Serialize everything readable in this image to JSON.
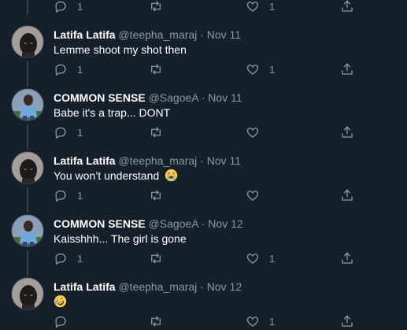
{
  "colors": {
    "background": "#15202b",
    "text": "#ffffff",
    "muted": "#8899a6",
    "line": "#38444d"
  },
  "top_actions": {
    "reply_count": "1",
    "like_count": "1"
  },
  "tweets": [
    {
      "name": "Latifa Latifa",
      "handle": "@teepha_maraj",
      "date": "Nov 11",
      "text": "Lemme shoot my shot then",
      "emoji": "",
      "reply_count": "1",
      "retweet_count": "",
      "like_count": "1"
    },
    {
      "name": "COMMON SENSE",
      "handle": "@SagoeA",
      "date": "Nov 11",
      "text": "Babe it's a trap... DONT",
      "emoji": "",
      "reply_count": "1",
      "retweet_count": "",
      "like_count": ""
    },
    {
      "name": "Latifa Latifa",
      "handle": "@teepha_maraj",
      "date": "Nov 11",
      "text": "You won’t understand",
      "emoji": "loudly-crying-face",
      "reply_count": "1",
      "retweet_count": "",
      "like_count": ""
    },
    {
      "name": "COMMON SENSE",
      "handle": "@SagoeA",
      "date": "Nov 12",
      "text": "Kaisshhh... The girl is gone",
      "emoji": "",
      "reply_count": "1",
      "retweet_count": "",
      "like_count": "1"
    },
    {
      "name": "Latifa Latifa",
      "handle": "@teepha_maraj",
      "date": "Nov 12",
      "text": "",
      "emoji": "rolling-on-floor-laughing",
      "reply_count": "",
      "retweet_count": "",
      "like_count": "1"
    }
  ]
}
